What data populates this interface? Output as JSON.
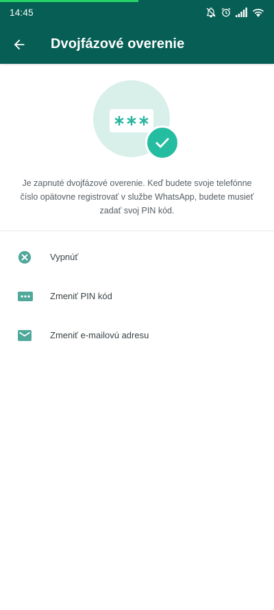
{
  "status_bar": {
    "time": "14:45",
    "icons": [
      "bell-off-icon",
      "alarm-icon",
      "signal-icon",
      "wifi-icon"
    ]
  },
  "app_bar": {
    "title": "Dvojfázové overenie",
    "back_icon": "arrow-left-icon"
  },
  "hero": {
    "pin_mask": "***",
    "badge_icon": "check-icon"
  },
  "description": "Je zapnuté dvojfázové overenie. Keď budete svoje telefónne číslo opätovne registrovať v službe WhatsApp, budete musieť zadať svoj PIN kód.",
  "menu": {
    "items": [
      {
        "label": "Vypnúť",
        "icon": "close-circle-icon"
      },
      {
        "label": "Zmeniť PIN kód",
        "icon": "pin-dots-icon"
      },
      {
        "label": "Zmeniť e-mailovú adresu",
        "icon": "mail-icon"
      }
    ]
  },
  "colors": {
    "app_bar": "#075e54",
    "accent": "#25bda1",
    "icon": "#4fa89a",
    "hero_bg": "#d9efea"
  }
}
